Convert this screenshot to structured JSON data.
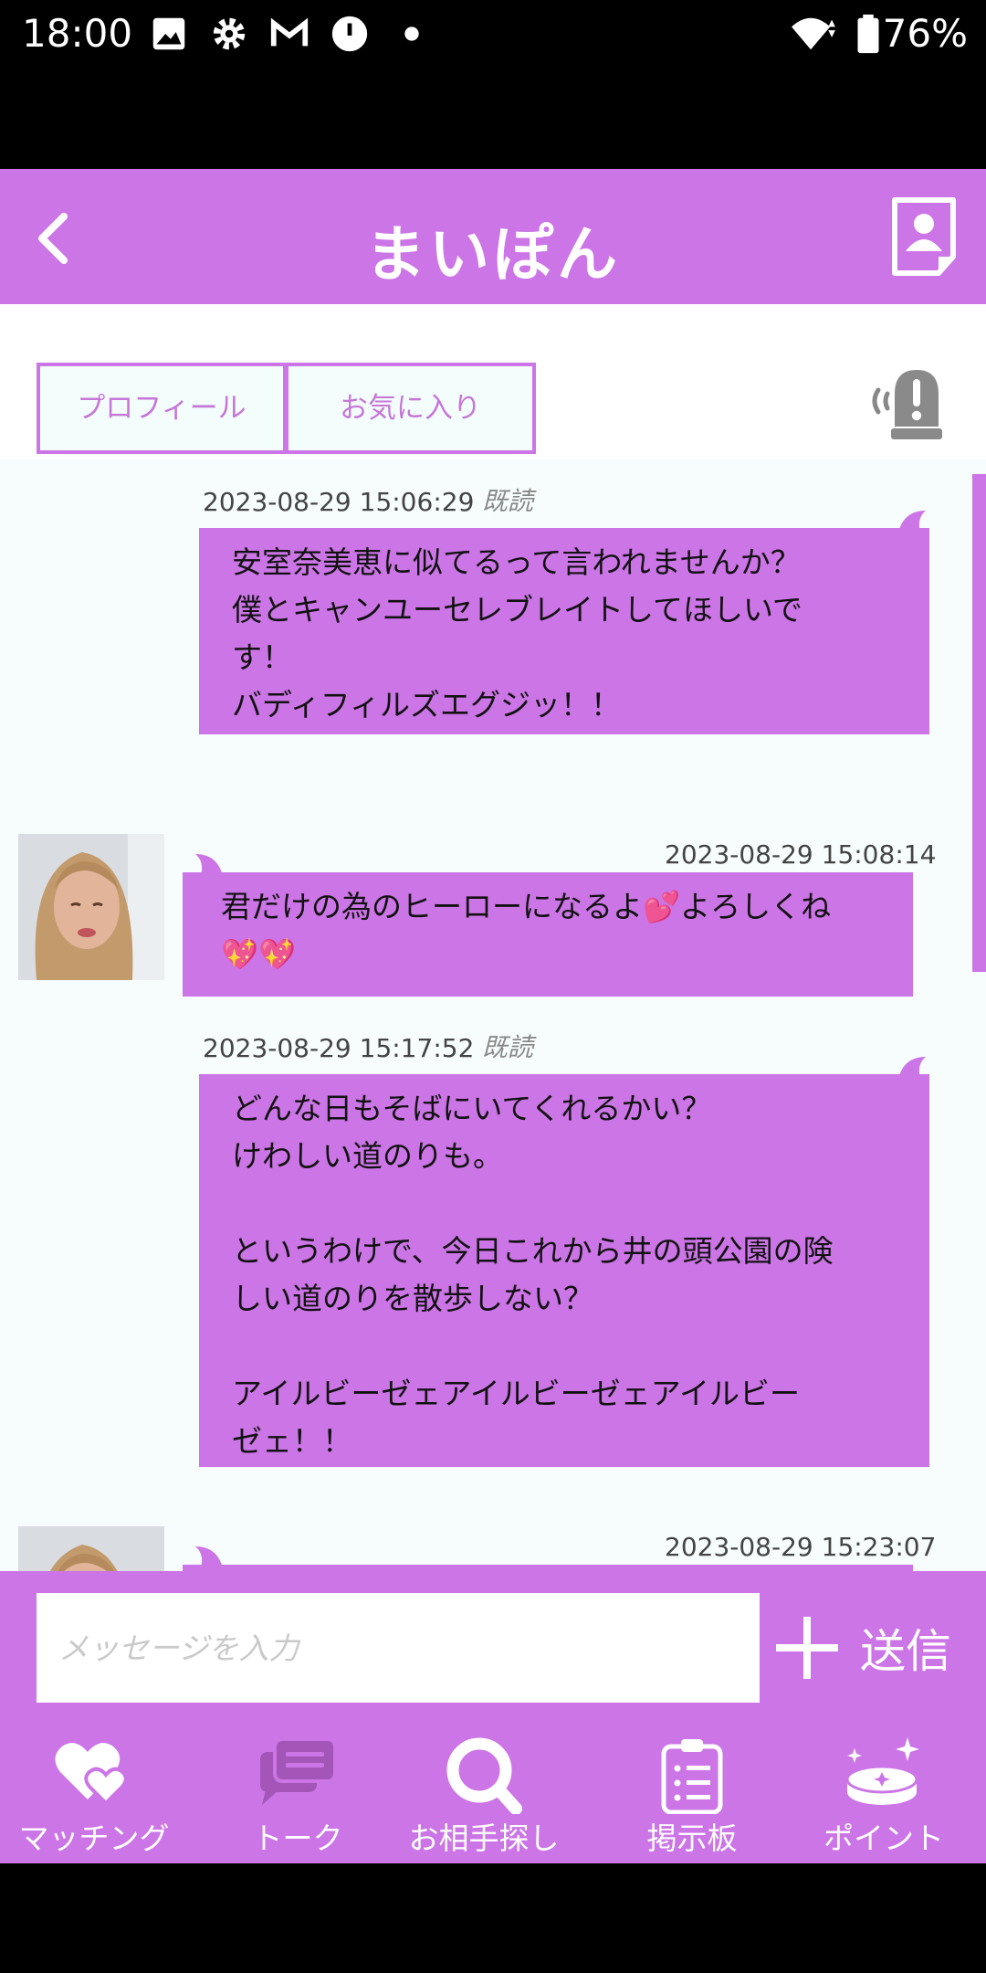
{
  "status_bar": {
    "time": "18:00",
    "battery": "76%",
    "icons": [
      "image-icon",
      "gear-icon",
      "gmail-icon",
      "clock-icon",
      "dot-icon",
      "wifi-icon",
      "battery-icon"
    ]
  },
  "header": {
    "title": "まいぽん",
    "back_icon": "chevron-left-icon",
    "profile_icon": "profile-card-icon"
  },
  "tabs": {
    "profile": "プロフィール",
    "favorite": "お気に入り"
  },
  "messages": [
    {
      "direction": "sent",
      "timestamp": "2023-08-29 15:06:29",
      "read": "既読",
      "text": "安室奈美恵に似てるって言われませんか？\n僕とキャンユーセレブレイトしてほしいで\nす！\nバディフィルズエグジッ！！"
    },
    {
      "direction": "received",
      "timestamp": "2023-08-29 15:08:14",
      "text": "君だけの為のヒーローになるよ💕よろしくね\n💖💖"
    },
    {
      "direction": "sent",
      "timestamp": "2023-08-29 15:17:52",
      "read": "既読",
      "text": "どんな日もそばにいてくれるかい？\nけわしい道のりも。\n\nというわけで、今日これから井の頭公園の険\nしい道のりを散歩しない？\n\nアイルビーゼェアイルビーゼェアイルビー\nゼェ！！"
    },
    {
      "direction": "received",
      "timestamp": "2023-08-29 15:23:07",
      "text": ""
    }
  ],
  "input": {
    "placeholder": "メッセージを入力",
    "send_label": "送信"
  },
  "nav": [
    {
      "label": "マッチング",
      "icon": "hearts-icon"
    },
    {
      "label": "トーク",
      "icon": "chat-bubbles-icon"
    },
    {
      "label": "お相手探し",
      "icon": "search-icon"
    },
    {
      "label": "掲示板",
      "icon": "clipboard-icon"
    },
    {
      "label": "ポイント",
      "icon": "coin-sparkle-icon"
    }
  ],
  "colors": {
    "accent": "#cc75e6",
    "chat_bg": "#f7fcfd"
  }
}
